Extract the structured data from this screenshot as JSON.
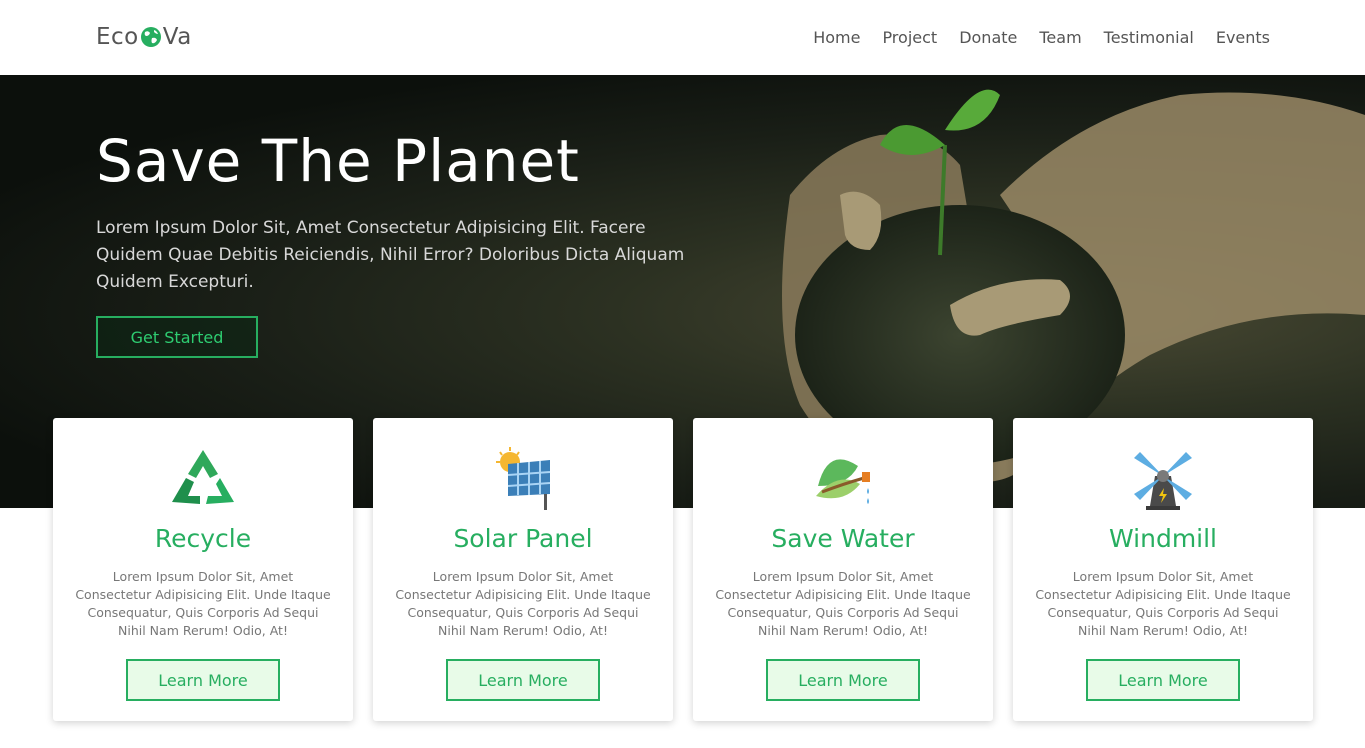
{
  "brand": {
    "name_part1": "Eco",
    "name_part2": "Va",
    "accent": "#27ae60"
  },
  "nav": {
    "items": [
      {
        "label": "Home"
      },
      {
        "label": "Project"
      },
      {
        "label": "Donate"
      },
      {
        "label": "Team"
      },
      {
        "label": "Testimonial"
      },
      {
        "label": "Events"
      }
    ]
  },
  "hero": {
    "title": "Save The Planet",
    "text": "Lorem Ipsum Dolor Sit, Amet Consectetur Adipisicing Elit. Facere Quidem Quae Debitis Reiciendis, Nihil Error? Doloribus Dicta Aliquam Quidem Excepturi.",
    "button": "Get Started"
  },
  "cards": [
    {
      "icon": "recycle-icon",
      "title": "Recycle",
      "text": "Lorem Ipsum Dolor Sit, Amet Consectetur Adipisicing Elit. Unde Itaque Consequatur, Quis Corporis Ad Sequi Nihil Nam Rerum! Odio, At!",
      "button": "Learn More"
    },
    {
      "icon": "solar-panel-icon",
      "title": "Solar Panel",
      "text": "Lorem Ipsum Dolor Sit, Amet Consectetur Adipisicing Elit. Unde Itaque Consequatur, Quis Corporis Ad Sequi Nihil Nam Rerum! Odio, At!",
      "button": "Learn More"
    },
    {
      "icon": "leaf-water-icon",
      "title": "Save Water",
      "text": "Lorem Ipsum Dolor Sit, Amet Consectetur Adipisicing Elit. Unde Itaque Consequatur, Quis Corporis Ad Sequi Nihil Nam Rerum! Odio, At!",
      "button": "Learn More"
    },
    {
      "icon": "windmill-icon",
      "title": "Windmill",
      "text": "Lorem Ipsum Dolor Sit, Amet Consectetur Adipisicing Elit. Unde Itaque Consequatur, Quis Corporis Ad Sequi Nihil Nam Rerum! Odio, At!",
      "button": "Learn More"
    }
  ]
}
